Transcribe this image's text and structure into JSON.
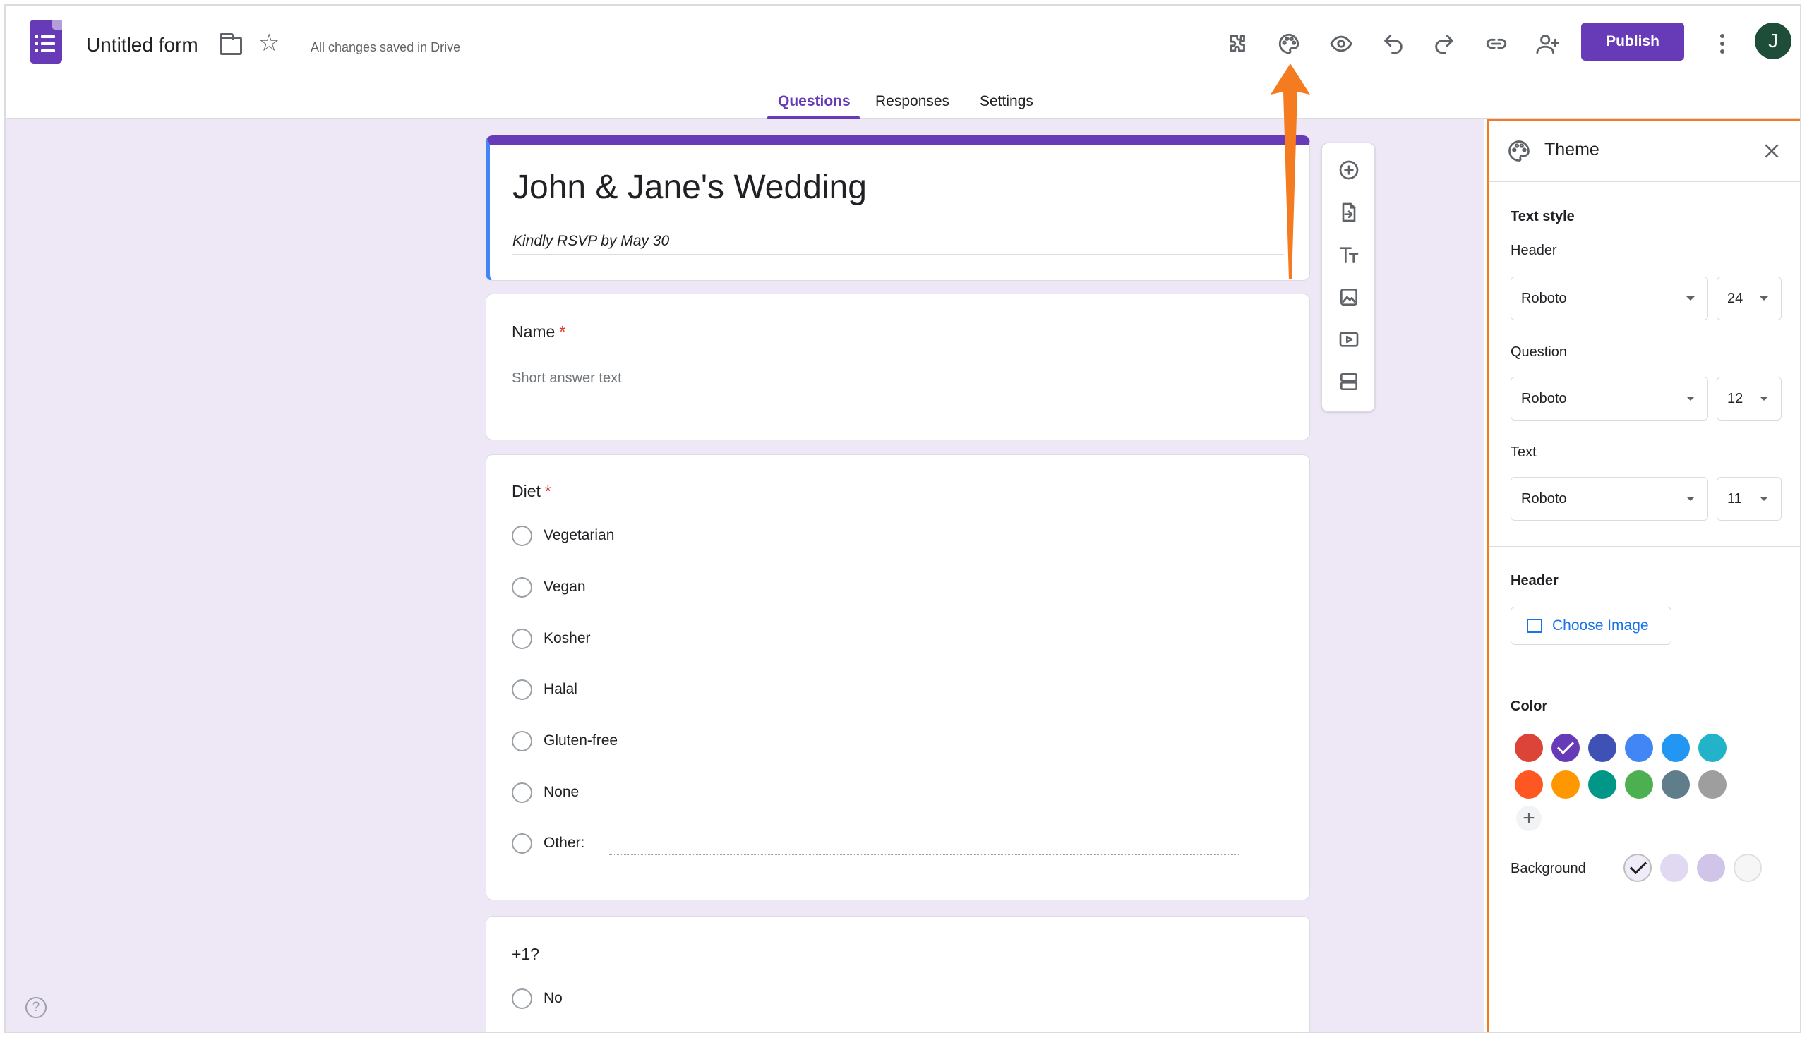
{
  "header": {
    "doc_title": "Untitled form",
    "save_status": "All changes saved in Drive",
    "publish_label": "Publish",
    "avatar_initial": "J",
    "tools": [
      "addons-icon",
      "palette-icon",
      "preview-icon",
      "undo-icon",
      "redo-icon",
      "link-icon",
      "add-collaborator-icon"
    ]
  },
  "tabs": [
    {
      "label": "Questions",
      "active": true
    },
    {
      "label": "Responses",
      "active": false
    },
    {
      "label": "Settings",
      "active": false
    }
  ],
  "form": {
    "title": "John & Jane's Wedding",
    "description": "Kindly RSVP by May 30",
    "questions": [
      {
        "title": "Name",
        "required": "*",
        "placeholder": "Short answer text"
      },
      {
        "title": "Diet",
        "required": "*",
        "options": [
          "Vegetarian",
          "Vegan",
          "Kosher",
          "Halal",
          "Gluten-free",
          "None",
          "Other:"
        ]
      },
      {
        "title": "+1?",
        "options": [
          "No"
        ]
      }
    ]
  },
  "side_toolbar": [
    "add-question-icon",
    "import-questions-icon",
    "add-title-icon",
    "add-image-icon",
    "add-video-icon",
    "add-section-icon"
  ],
  "theme": {
    "title": "Theme",
    "text_style_label": "Text style",
    "header_label": "Header",
    "header_font": "Roboto",
    "header_size": "24",
    "question_label": "Question",
    "question_font": "Roboto",
    "question_size": "12",
    "text_label": "Text",
    "text_font": "Roboto",
    "text_size": "11",
    "header_section_label": "Header",
    "choose_image_label": "Choose Image",
    "color_label": "Color",
    "colors": [
      "#db4437",
      "#673ab7",
      "#3f51b5",
      "#4285f4",
      "#2196f3",
      "#22b3c8",
      "#ff5722",
      "#ff9800",
      "#009688",
      "#4caf50",
      "#607d8b",
      "#9e9e9e"
    ],
    "selected_color": "#673ab7",
    "background_label": "Background",
    "backgrounds": [
      "#f0ebf8",
      "#e1d8f1",
      "#d1c4e9",
      "#f6f6f6"
    ]
  },
  "annotation": {
    "arrow_color": "#f47b20"
  }
}
